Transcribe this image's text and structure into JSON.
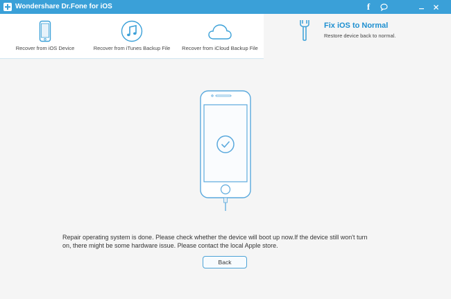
{
  "window": {
    "title": "Wondershare Dr.Fone for iOS",
    "facebook_glyph": "f"
  },
  "toolbar": {
    "items": [
      {
        "label": "Recover from iOS Device",
        "icon": "phone-icon"
      },
      {
        "label": "Recover from iTunes Backup File",
        "icon": "music-note-icon"
      },
      {
        "label": "Recover from iCloud Backup File",
        "icon": "cloud-icon"
      }
    ],
    "fix": {
      "title": "Fix iOS to Normal",
      "subtitle": "Restore device back to normal.",
      "icon": "wrench-icon"
    }
  },
  "main": {
    "message_line1": "Repair operating system is done. Please check whether the device will boot up now.If the device still won't turn",
    "message_line2": "on, there might be some hardware issue. Please contact the local Apple store.",
    "back_label": "Back"
  },
  "colors": {
    "titlebar": "#3aa0d8",
    "accent": "#1d8fd0",
    "background": "#f5f5f5"
  }
}
